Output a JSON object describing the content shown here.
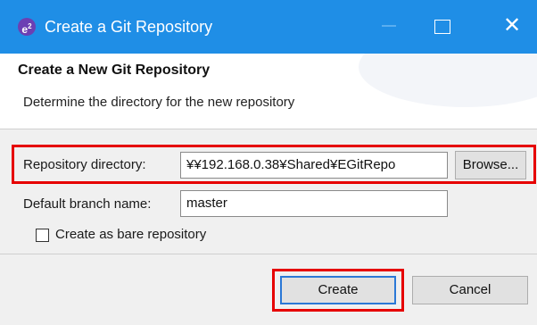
{
  "window": {
    "title": "Create a Git Repository",
    "app_icon": "eclipse-icon",
    "controls": [
      "maximize-icon",
      "close-icon"
    ]
  },
  "header": {
    "title": "Create a New Git Repository",
    "description": "Determine the directory for the new repository"
  },
  "form": {
    "repo_dir_label": "Repository directory:",
    "repo_dir_value": "¥¥192.168.0.38¥Shared¥EGitRepo",
    "browse_label": "Browse...",
    "branch_label": "Default branch name:",
    "branch_value": "master",
    "bare_label": "Create as bare repository",
    "bare_checked": false
  },
  "buttons": {
    "create_label": "Create",
    "cancel_label": "Cancel"
  },
  "colors": {
    "titlebar": "#1f8ee6",
    "highlight": "#e60000",
    "default_button_border": "#2b78d6"
  }
}
